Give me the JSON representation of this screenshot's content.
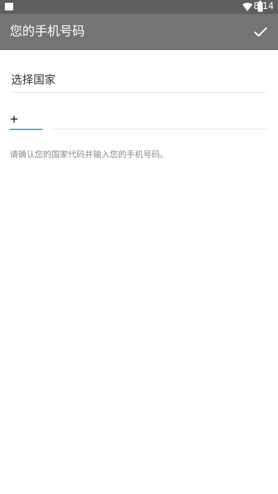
{
  "status_bar": {
    "time": "8:14",
    "icons": [
      "notification-icon",
      "wifi-icon",
      "battery-icon"
    ]
  },
  "app_bar": {
    "title": "您的手机号码",
    "confirm_icon": "check-icon"
  },
  "form": {
    "country_label": "选择国家",
    "country_code_prefix": "+",
    "country_code_value": "",
    "phone_value": "",
    "hint": "请确认您的国家代码并输入您的手机号码。"
  },
  "colors": {
    "status_bar_bg": "#5f5f5f",
    "app_bar_bg": "#747474",
    "accent": "#33b5c9"
  }
}
